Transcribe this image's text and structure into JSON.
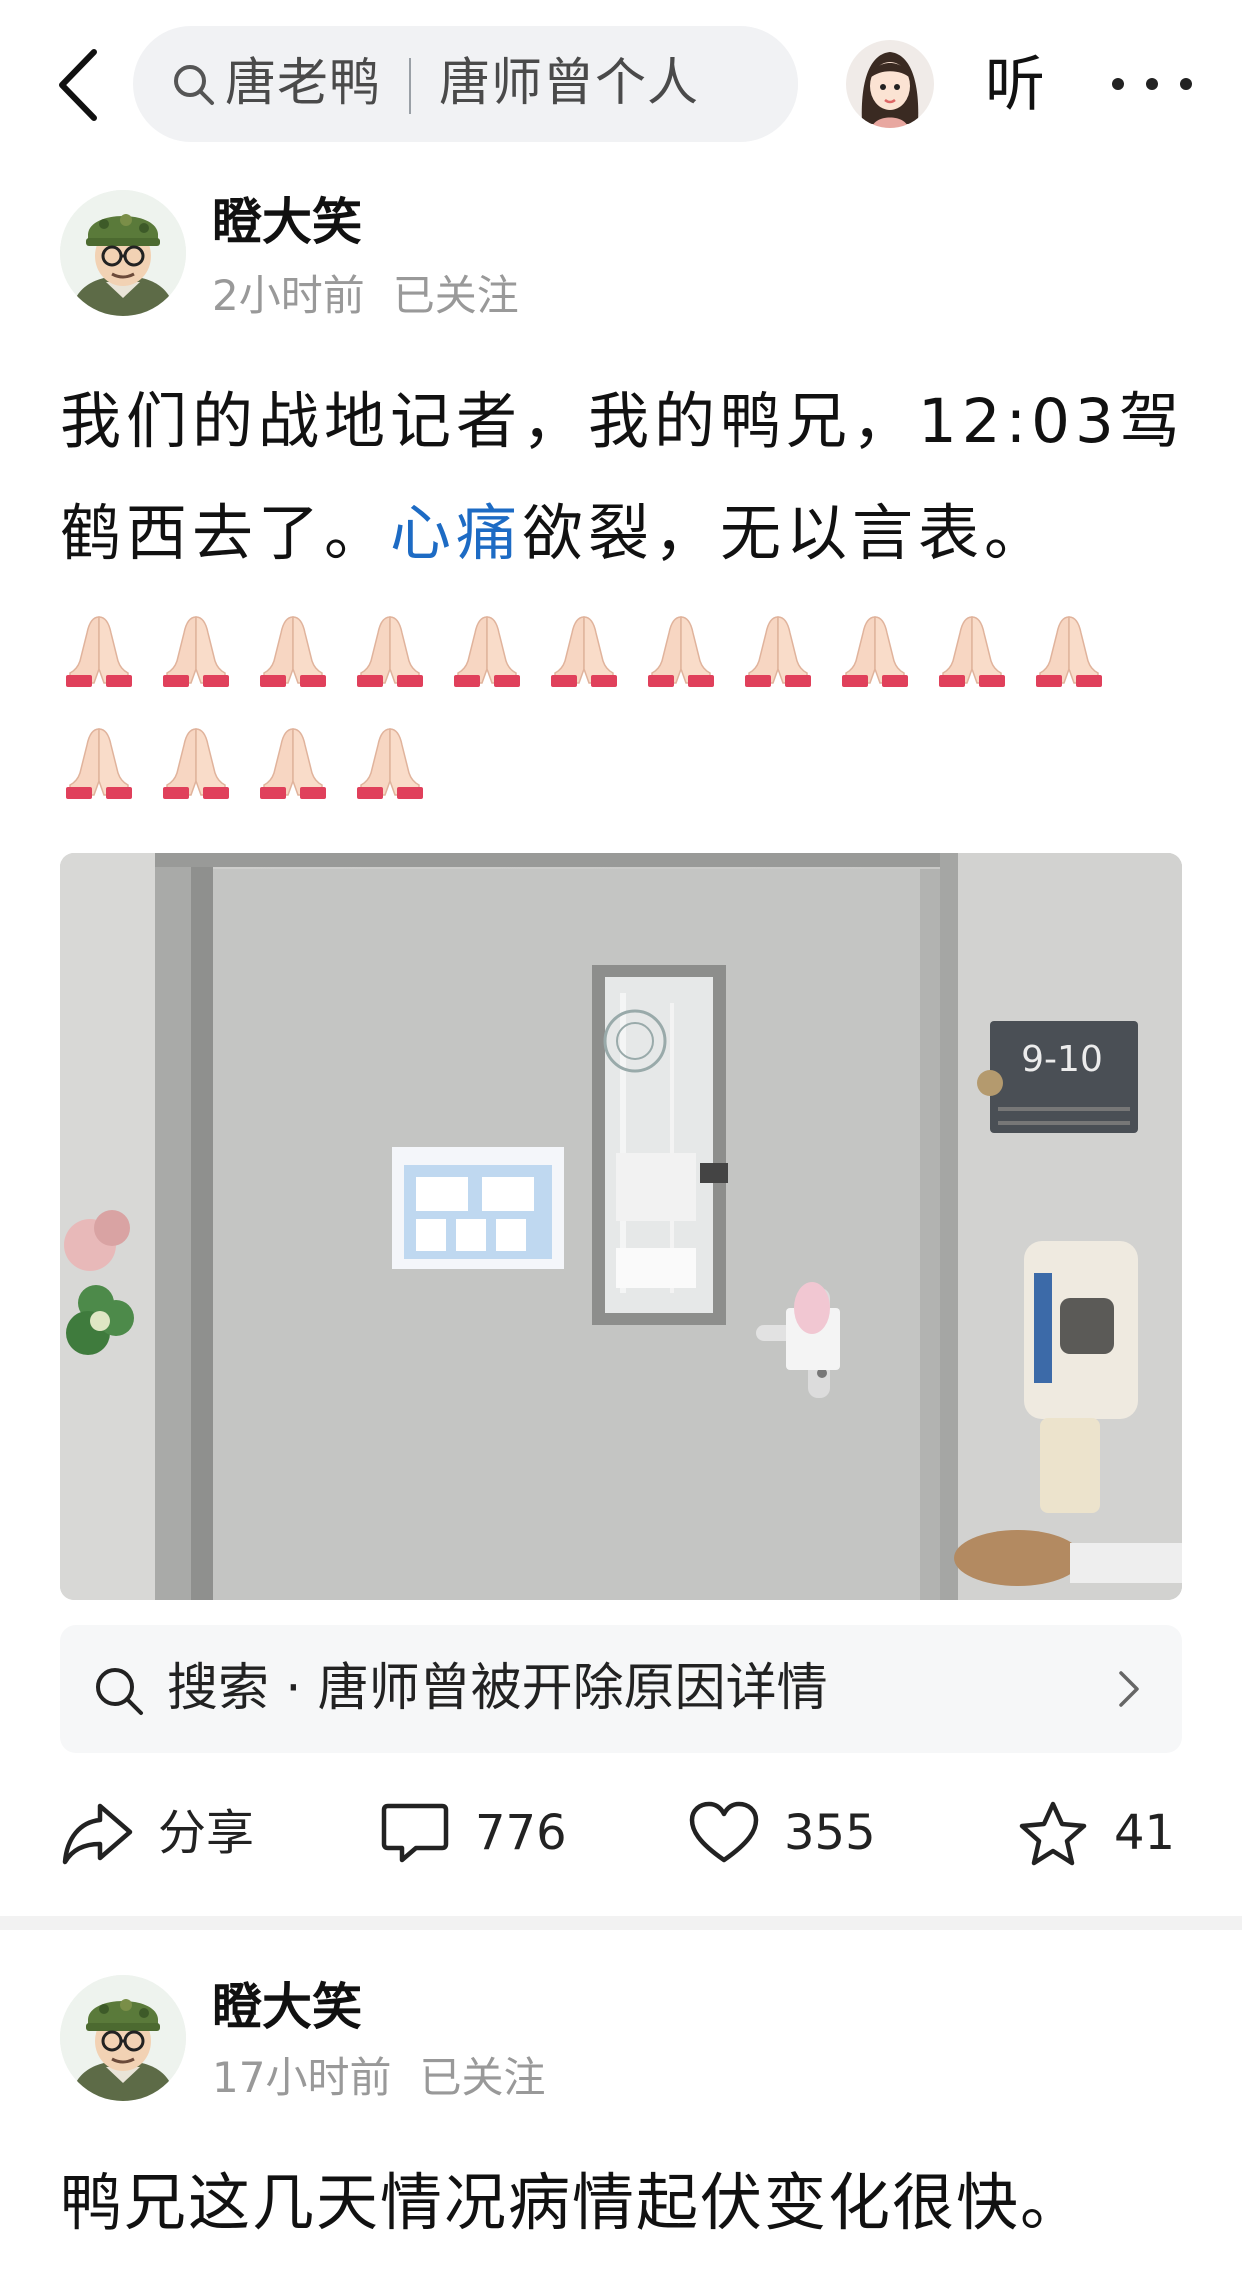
{
  "top_bar": {
    "search_text_1": "唐老鸭",
    "search_text_2": "唐师曾个人",
    "listen_label": "听"
  },
  "posts": [
    {
      "author": "瞪大笑",
      "time": "2小时前",
      "follow_status": "已关注",
      "text_1": "我们的战地记者，我的鸭兄，12:03驾鹤西去了。",
      "text_highlight": "心痛",
      "text_2": "欲裂，无以言表。",
      "emoji_name": "folded-hands-emoji",
      "emoji_count": 15,
      "image_sign_label": "9-10",
      "search_suggestion": "搜索 · 唐师曾被开除原因详情",
      "share_label": "分享",
      "comment_count": "776",
      "like_count": "355",
      "favorite_count": "41"
    },
    {
      "author": "瞪大笑",
      "time": "17小时前",
      "follow_status": "已关注",
      "text": "鸭兄这几天情况病情起伏变化很快。"
    }
  ],
  "colors": {
    "link": "#1d6bc4",
    "meta": "#999999",
    "search_bg": "#f1f2f4"
  }
}
